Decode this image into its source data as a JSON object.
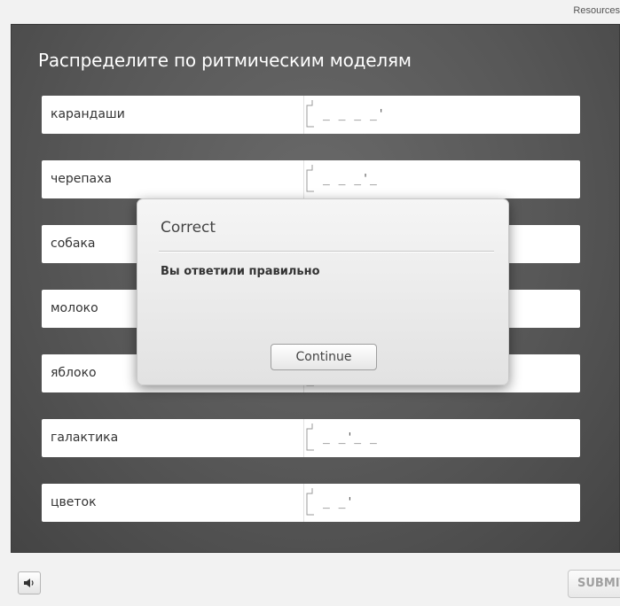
{
  "header": {
    "resources_label": "Resources"
  },
  "activity": {
    "title": "Распределите по ритмическим моделям",
    "rows": [
      {
        "word": "карандаши",
        "pattern": "_ _ _ _'"
      },
      {
        "word": "черепаха",
        "pattern": "_ _ _'_"
      },
      {
        "word": "собака",
        "pattern": ""
      },
      {
        "word": "молоко",
        "pattern": ""
      },
      {
        "word": "яблоко",
        "pattern": ""
      },
      {
        "word": "галактика",
        "pattern": "_ _'_ _"
      },
      {
        "word": "цветок",
        "pattern": "_ _'"
      }
    ]
  },
  "dialog": {
    "title": "Correct",
    "message": "Вы ответили правильно",
    "button_label": "Continue"
  },
  "footer": {
    "sound_icon": "speaker-icon",
    "submit_label": "SUBMIT"
  },
  "colors": {
    "stage_bg": "#575757",
    "row_bg": "#ffffff",
    "dialog_bg": "#ececec"
  }
}
